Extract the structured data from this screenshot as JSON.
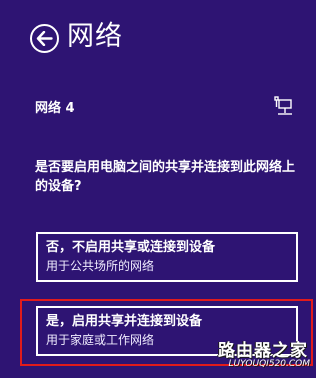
{
  "header": {
    "title": "网络",
    "back_icon": "back-arrow-circle-icon"
  },
  "network": {
    "name": "网络 4",
    "icon": "ethernet-network-icon"
  },
  "question": "是否要启用电脑之间的共享并连接到此网络上的设备?",
  "options": [
    {
      "title": "否，不启用共享或连接到设备",
      "description": "用于公共场所的网络"
    },
    {
      "title": "是，启用共享并连接到设备",
      "description": "用于家庭或工作网络",
      "highlighted": true
    }
  ],
  "watermark": {
    "text": "路由器之家",
    "url_text": "LUYOUQI520.COM"
  },
  "colors": {
    "background": "#2e1473",
    "text": "#ffffff",
    "highlight": "#e21b1b"
  }
}
